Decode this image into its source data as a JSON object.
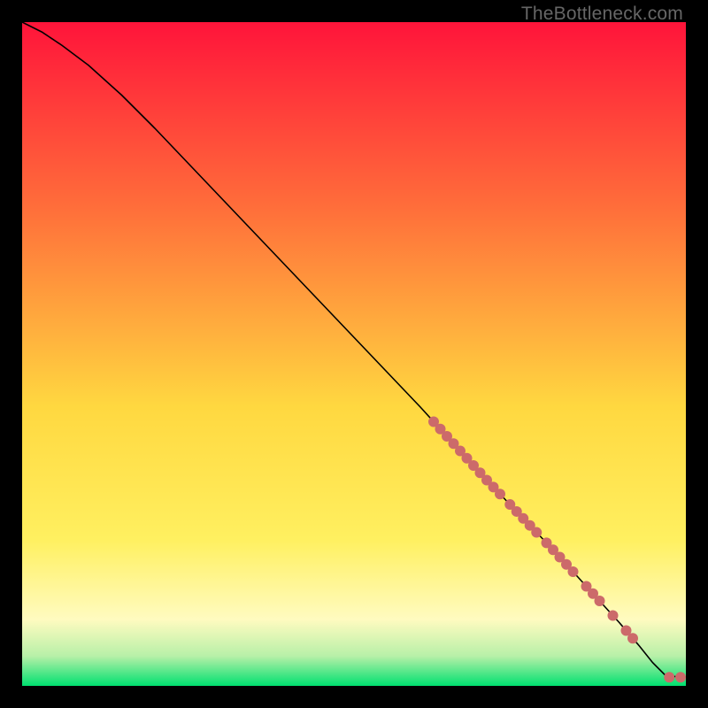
{
  "watermark": "TheBottleneck.com",
  "colors": {
    "bg_top": "#ff143a",
    "bg_mid_upper": "#ff6e3a",
    "bg_mid": "#ffd840",
    "bg_mid_lower": "#fff060",
    "bg_cream": "#fffbc0",
    "bg_green_pale": "#b8f0a8",
    "bg_green": "#00e070",
    "curve": "#000000",
    "markers": "#cc6a6a"
  },
  "chart_data": {
    "type": "line",
    "title": "",
    "xlabel": "",
    "ylabel": "",
    "xlim": [
      0,
      100
    ],
    "ylim": [
      0,
      100
    ],
    "curve": {
      "x": [
        0,
        3,
        6,
        10,
        15,
        20,
        30,
        40,
        50,
        60,
        70,
        80,
        90,
        93,
        95,
        97,
        100
      ],
      "y": [
        100,
        98.5,
        96.5,
        93.5,
        89,
        84,
        73.5,
        63,
        52.5,
        42,
        31,
        20.5,
        9.5,
        6,
        3.5,
        1.5,
        1.3
      ]
    },
    "markers_on_curve_x": [
      62,
      63,
      64,
      65,
      66,
      67,
      68,
      69,
      70,
      71,
      72,
      73.5,
      74.5,
      75.5,
      76.5,
      77.5,
      79,
      80,
      81,
      82,
      83,
      85,
      86,
      87,
      89,
      91,
      92
    ],
    "tail_markers": [
      {
        "x": 97.5,
        "y": 1.3
      },
      {
        "x": 99.2,
        "y": 1.3
      }
    ],
    "gradient_stops": [
      {
        "offset": 0.0,
        "key": "bg_top"
      },
      {
        "offset": 0.28,
        "key": "bg_mid_upper"
      },
      {
        "offset": 0.58,
        "key": "bg_mid"
      },
      {
        "offset": 0.78,
        "key": "bg_mid_lower"
      },
      {
        "offset": 0.9,
        "key": "bg_cream"
      },
      {
        "offset": 0.955,
        "key": "bg_green_pale"
      },
      {
        "offset": 1.0,
        "key": "bg_green"
      }
    ]
  }
}
